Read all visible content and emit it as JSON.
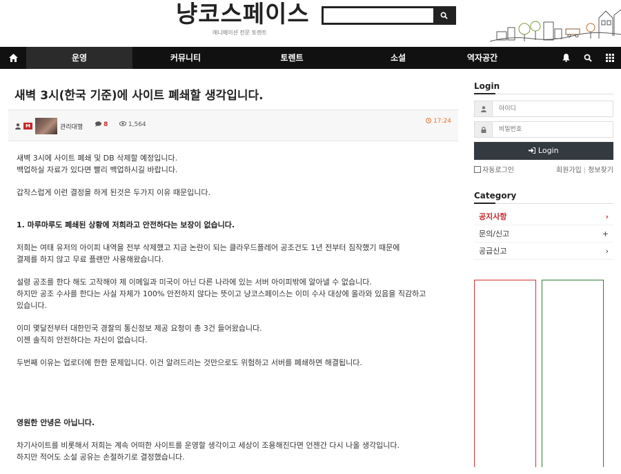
{
  "site": {
    "logo": "냥코스페이스",
    "tagline": "애니메이션 전문 토렌트"
  },
  "nav": {
    "items": [
      {
        "label": "운영",
        "active": true
      },
      {
        "label": "커뮤니티",
        "active": false
      },
      {
        "label": "토렌트",
        "active": false
      },
      {
        "label": "소설",
        "active": false
      },
      {
        "label": "역자공간",
        "active": false
      }
    ]
  },
  "post": {
    "title": "새벽 3시(한국 기준)에 사이트 폐쇄할 생각입니다.",
    "level_badge": "M",
    "author": "관리대행",
    "comment_count": "8",
    "views": "1,564",
    "time": "17:24",
    "paragraphs": [
      {
        "lines": [
          "새벽 3시에 사이트 폐쇄 및 DB 삭제할 예정입니다.",
          "백업하실 자료가 있다면 빨리 백업하시길 바랍니다."
        ]
      },
      {
        "lines": [
          "갑작스럽게 이런 결정을 하게 된것은 두가지 이유 때문입니다."
        ]
      },
      {
        "lines": [
          "1. 마루마루도 폐쇄된 상황에 저희라고 안전하다는 보장이 없습니다."
        ],
        "bold": true
      },
      {
        "lines": [
          "저희는 여태 유저의 아이피 내역을 전부 삭제했고 지금 논란이 되는 클라우드플레어 공조건도 1년 전부터 짐작했기 때문에",
          "결제를 하지 않고 무료 플랜만 사용해왔습니다."
        ]
      },
      {
        "lines": [
          "설령 공조를 한다 해도 고작해야 제 이메일과 미국이 아닌 다른 나라에 있는 서버 아이피밖에 알아낼 수 없습니다.",
          "하지만 공조 수사를 한다는 사실 자체가 100% 안전하지 않다는 뜻이고 냥코스페이스는 이미 수사 대상에 올라와 있음을 직감하고",
          "있습니다."
        ]
      },
      {
        "lines": [
          "이미 몇달전부터 대한민국 경찰의 통신정보 제공 요청이 총 3건 들어왔습니다.",
          "이젠 솔직히 안전하다는 자신이 없습니다."
        ]
      },
      {
        "lines": [
          "두번째 이유는 업로더에 한한 문제입니다. 이건 알려드리는 것만으로도 위험하고 서버를 폐쇄하면 해결됩니다."
        ]
      },
      {
        "lines": [
          "영원한 안녕은 아닙니다."
        ],
        "bold": true,
        "gap_before": true
      },
      {
        "lines": [
          "차기사이트를 비롯해서 저희는 계속 어떠한 사이트를 운영할 생각이고 세상이 조용해진다면 언젠간 다시 나올 생각입니다.",
          "하지만 적어도 소설 공유는 손절하기로 결정했습니다."
        ]
      }
    ]
  },
  "sidebar": {
    "login_title": "Login",
    "id_placeholder": "아이디",
    "pw_placeholder": "비밀번호",
    "login_button": "Login",
    "auto_login": "자동로그인",
    "signup": "회원가입",
    "find_info": "정보찾기",
    "category_title": "Category",
    "categories": [
      {
        "label": "공지사항",
        "marker": "›",
        "active": true
      },
      {
        "label": "문의/신고",
        "marker": "+",
        "active": false
      },
      {
        "label": "공급신고",
        "marker": "›",
        "active": false
      }
    ]
  },
  "icons": {
    "home": "home-icon",
    "search": "search-icon",
    "bell": "bell-icon",
    "grid": "grid-icon",
    "user": "user-icon",
    "lock": "lock-icon",
    "comment": "comment-icon",
    "eye": "eye-icon",
    "clock": "clock-icon"
  },
  "colors": {
    "accent": "#c62828",
    "nav_bg": "#111111",
    "time": "#e6742a",
    "ad_left": "#d32f2f",
    "ad_right": "#2e7d32"
  }
}
